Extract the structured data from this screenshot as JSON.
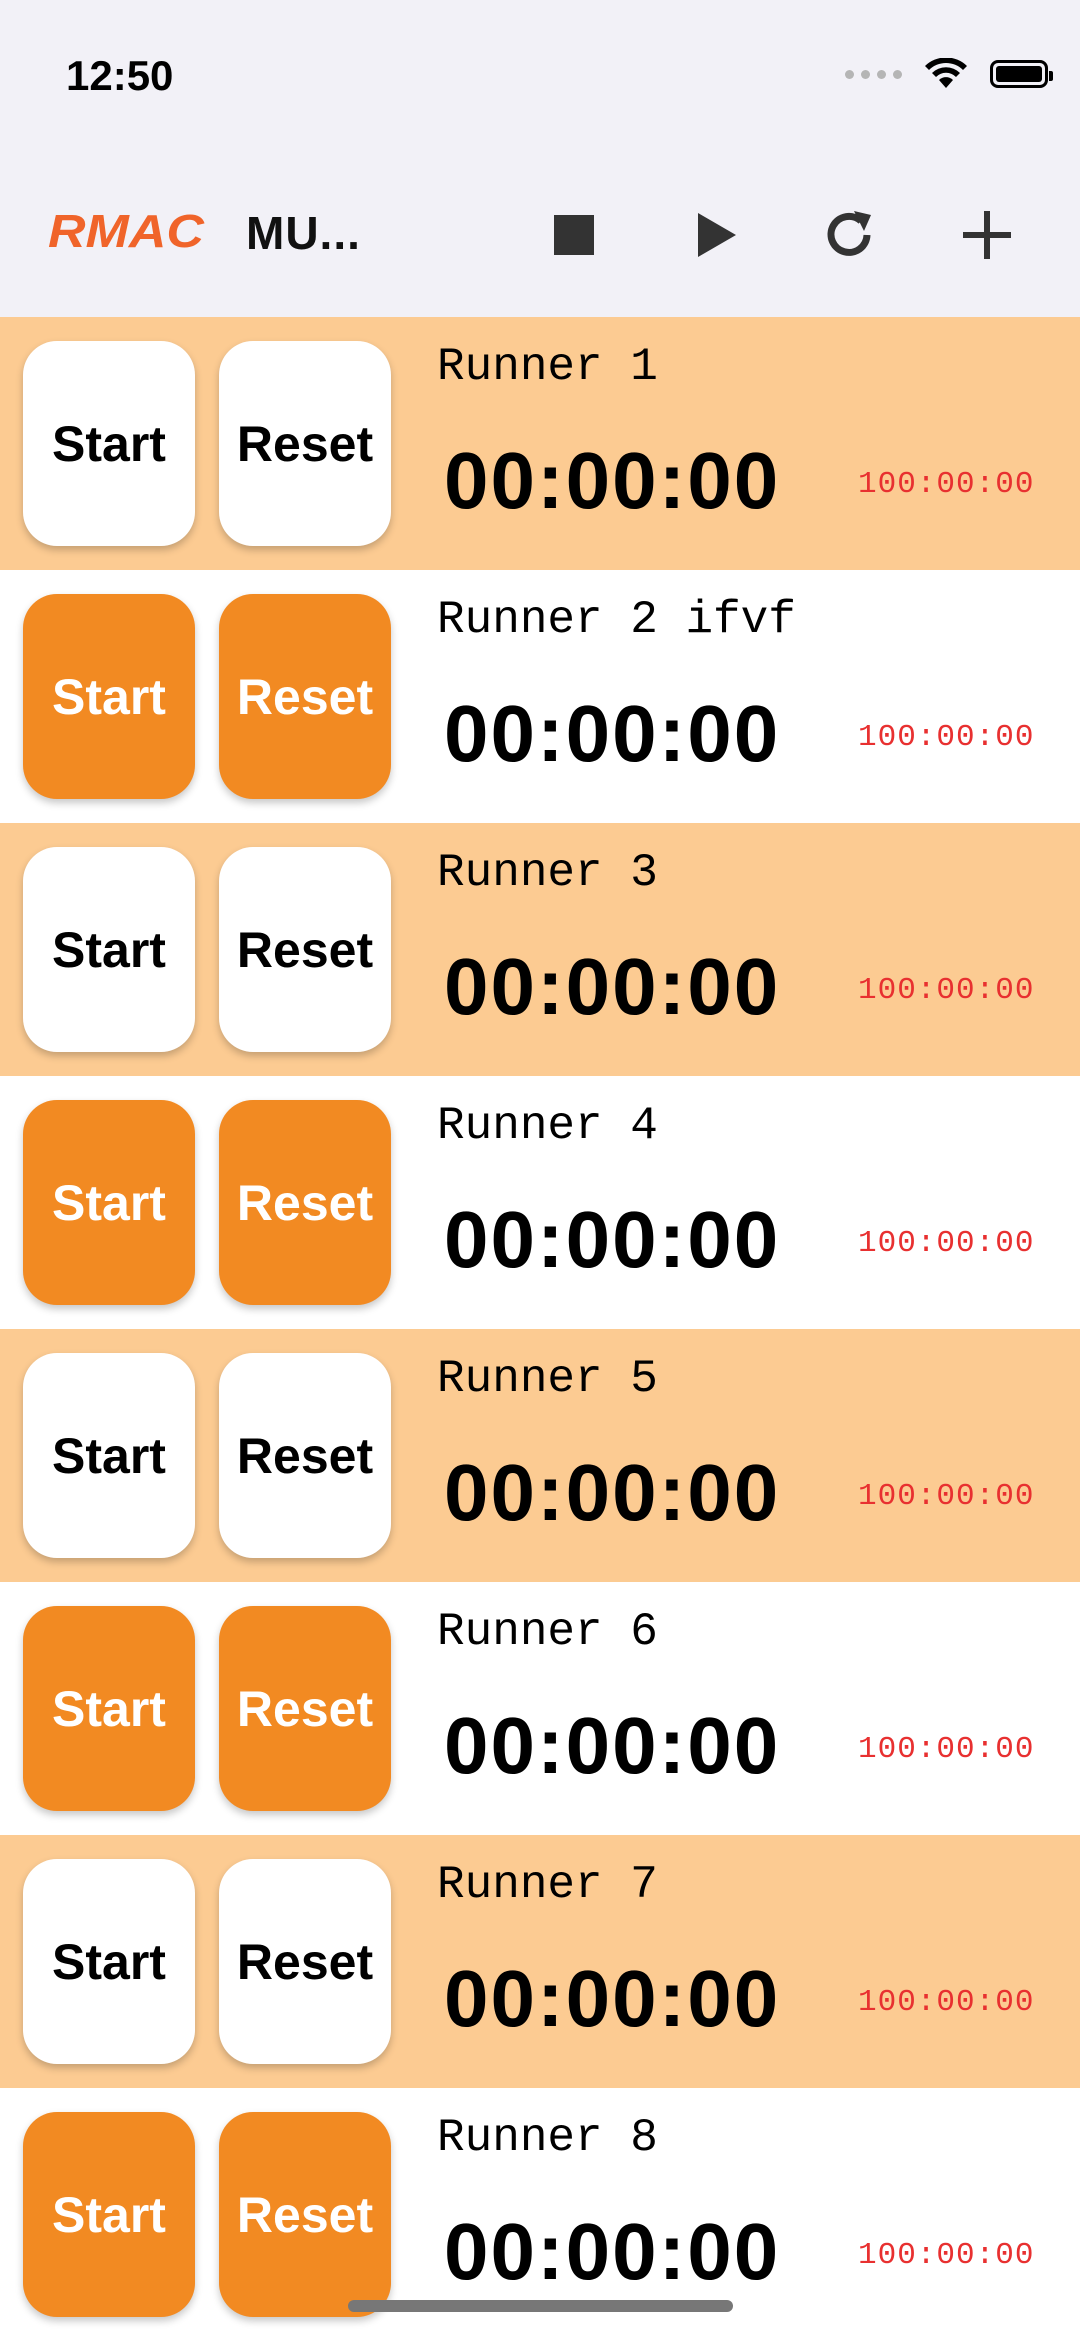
{
  "status": {
    "time": "12:50"
  },
  "app": {
    "logo_text": "RMAC",
    "title": "MU...",
    "toolbar": {
      "stop_icon": "stop-icon",
      "play_icon": "play-icon",
      "refresh_icon": "refresh-icon",
      "add_icon": "add-icon"
    }
  },
  "colors": {
    "tint_row": "#fccb92",
    "accent": "#f28a22",
    "limit_text": "#e83030"
  },
  "runners": [
    {
      "name": "Runner 1",
      "timer": "00:00:00",
      "limit": "100:00:00",
      "start_label": "Start",
      "reset_label": "Reset"
    },
    {
      "name": "Runner 2 ifvf",
      "timer": "00:00:00",
      "limit": "100:00:00",
      "start_label": "Start",
      "reset_label": "Reset"
    },
    {
      "name": "Runner 3",
      "timer": "00:00:00",
      "limit": "100:00:00",
      "start_label": "Start",
      "reset_label": "Reset"
    },
    {
      "name": "Runner 4",
      "timer": "00:00:00",
      "limit": "100:00:00",
      "start_label": "Start",
      "reset_label": "Reset"
    },
    {
      "name": "Runner 5",
      "timer": "00:00:00",
      "limit": "100:00:00",
      "start_label": "Start",
      "reset_label": "Reset"
    },
    {
      "name": "Runner 6",
      "timer": "00:00:00",
      "limit": "100:00:00",
      "start_label": "Start",
      "reset_label": "Reset"
    },
    {
      "name": "Runner 7",
      "timer": "00:00:00",
      "limit": "100:00:00",
      "start_label": "Start",
      "reset_label": "Reset"
    },
    {
      "name": "Runner 8",
      "timer": "00:00:00",
      "limit": "100:00:00",
      "start_label": "Start",
      "reset_label": "Reset"
    }
  ]
}
